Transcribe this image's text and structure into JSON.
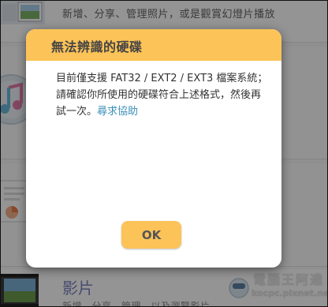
{
  "background": {
    "row1_text": "新增、分享、管理照片，或是觀賞幻燈片播放",
    "row4_title": "影片",
    "row4_text": "新增、分享、管理，以及瀏覽影片",
    "watermark_line1": "電腦王阿達",
    "watermark_line2": "kocpc.pixnet.net",
    "icons": [
      "photo-thumbnail",
      "music-icon",
      "document-icon",
      "video-thumbnail",
      "mascot-watermark"
    ]
  },
  "dialog": {
    "title": "無法辨識的硬碟",
    "message": "目前僅支援 FAT32 / EXT2 / EXT3 檔案系統；請確認你所使用的硬碟符合上述格式，然後再試一次。",
    "help_link": "尋求協助",
    "ok_label": "OK"
  },
  "colors": {
    "header": "#fcc358",
    "ok_button": "#fcc358",
    "link": "#3a8fb8",
    "overlay": "rgba(0,0,0,0.42)"
  }
}
